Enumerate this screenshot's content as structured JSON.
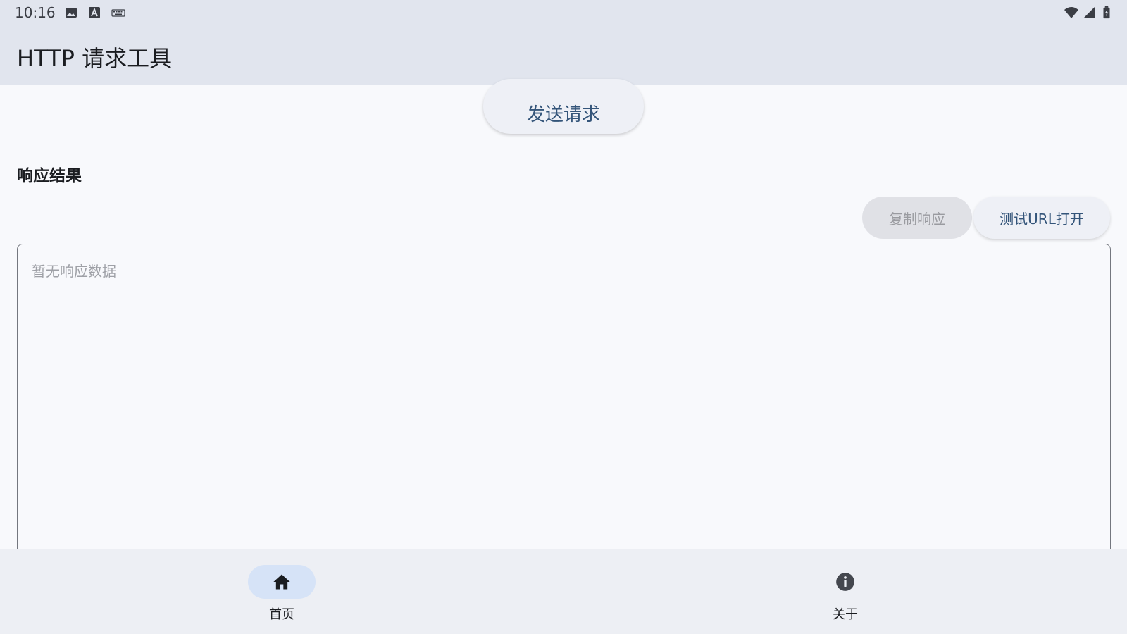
{
  "status_bar": {
    "time": "10:16",
    "left_icons": [
      "image-icon",
      "font-a-icon",
      "keyboard-icon"
    ],
    "right_icons": [
      "wifi-icon",
      "signal-icon",
      "battery-charging-icon"
    ]
  },
  "app_bar": {
    "title": "HTTP 请求工具"
  },
  "main": {
    "send_button_label": "发送请求",
    "response_section_title": "响应结果",
    "copy_button_label": "复制响应",
    "test_url_button_label": "测试URL打开",
    "response_placeholder": "暂无响应数据"
  },
  "bottom_nav": {
    "items": [
      {
        "label": "首页",
        "icon": "home-icon",
        "active": true
      },
      {
        "label": "关于",
        "icon": "info-icon",
        "active": false
      }
    ]
  },
  "colors": {
    "app_bar_bg": "#e1e5ee",
    "page_bg": "#f8f9fc",
    "accent_text": "#34557a",
    "nav_active_pill": "#d6e3f7"
  }
}
